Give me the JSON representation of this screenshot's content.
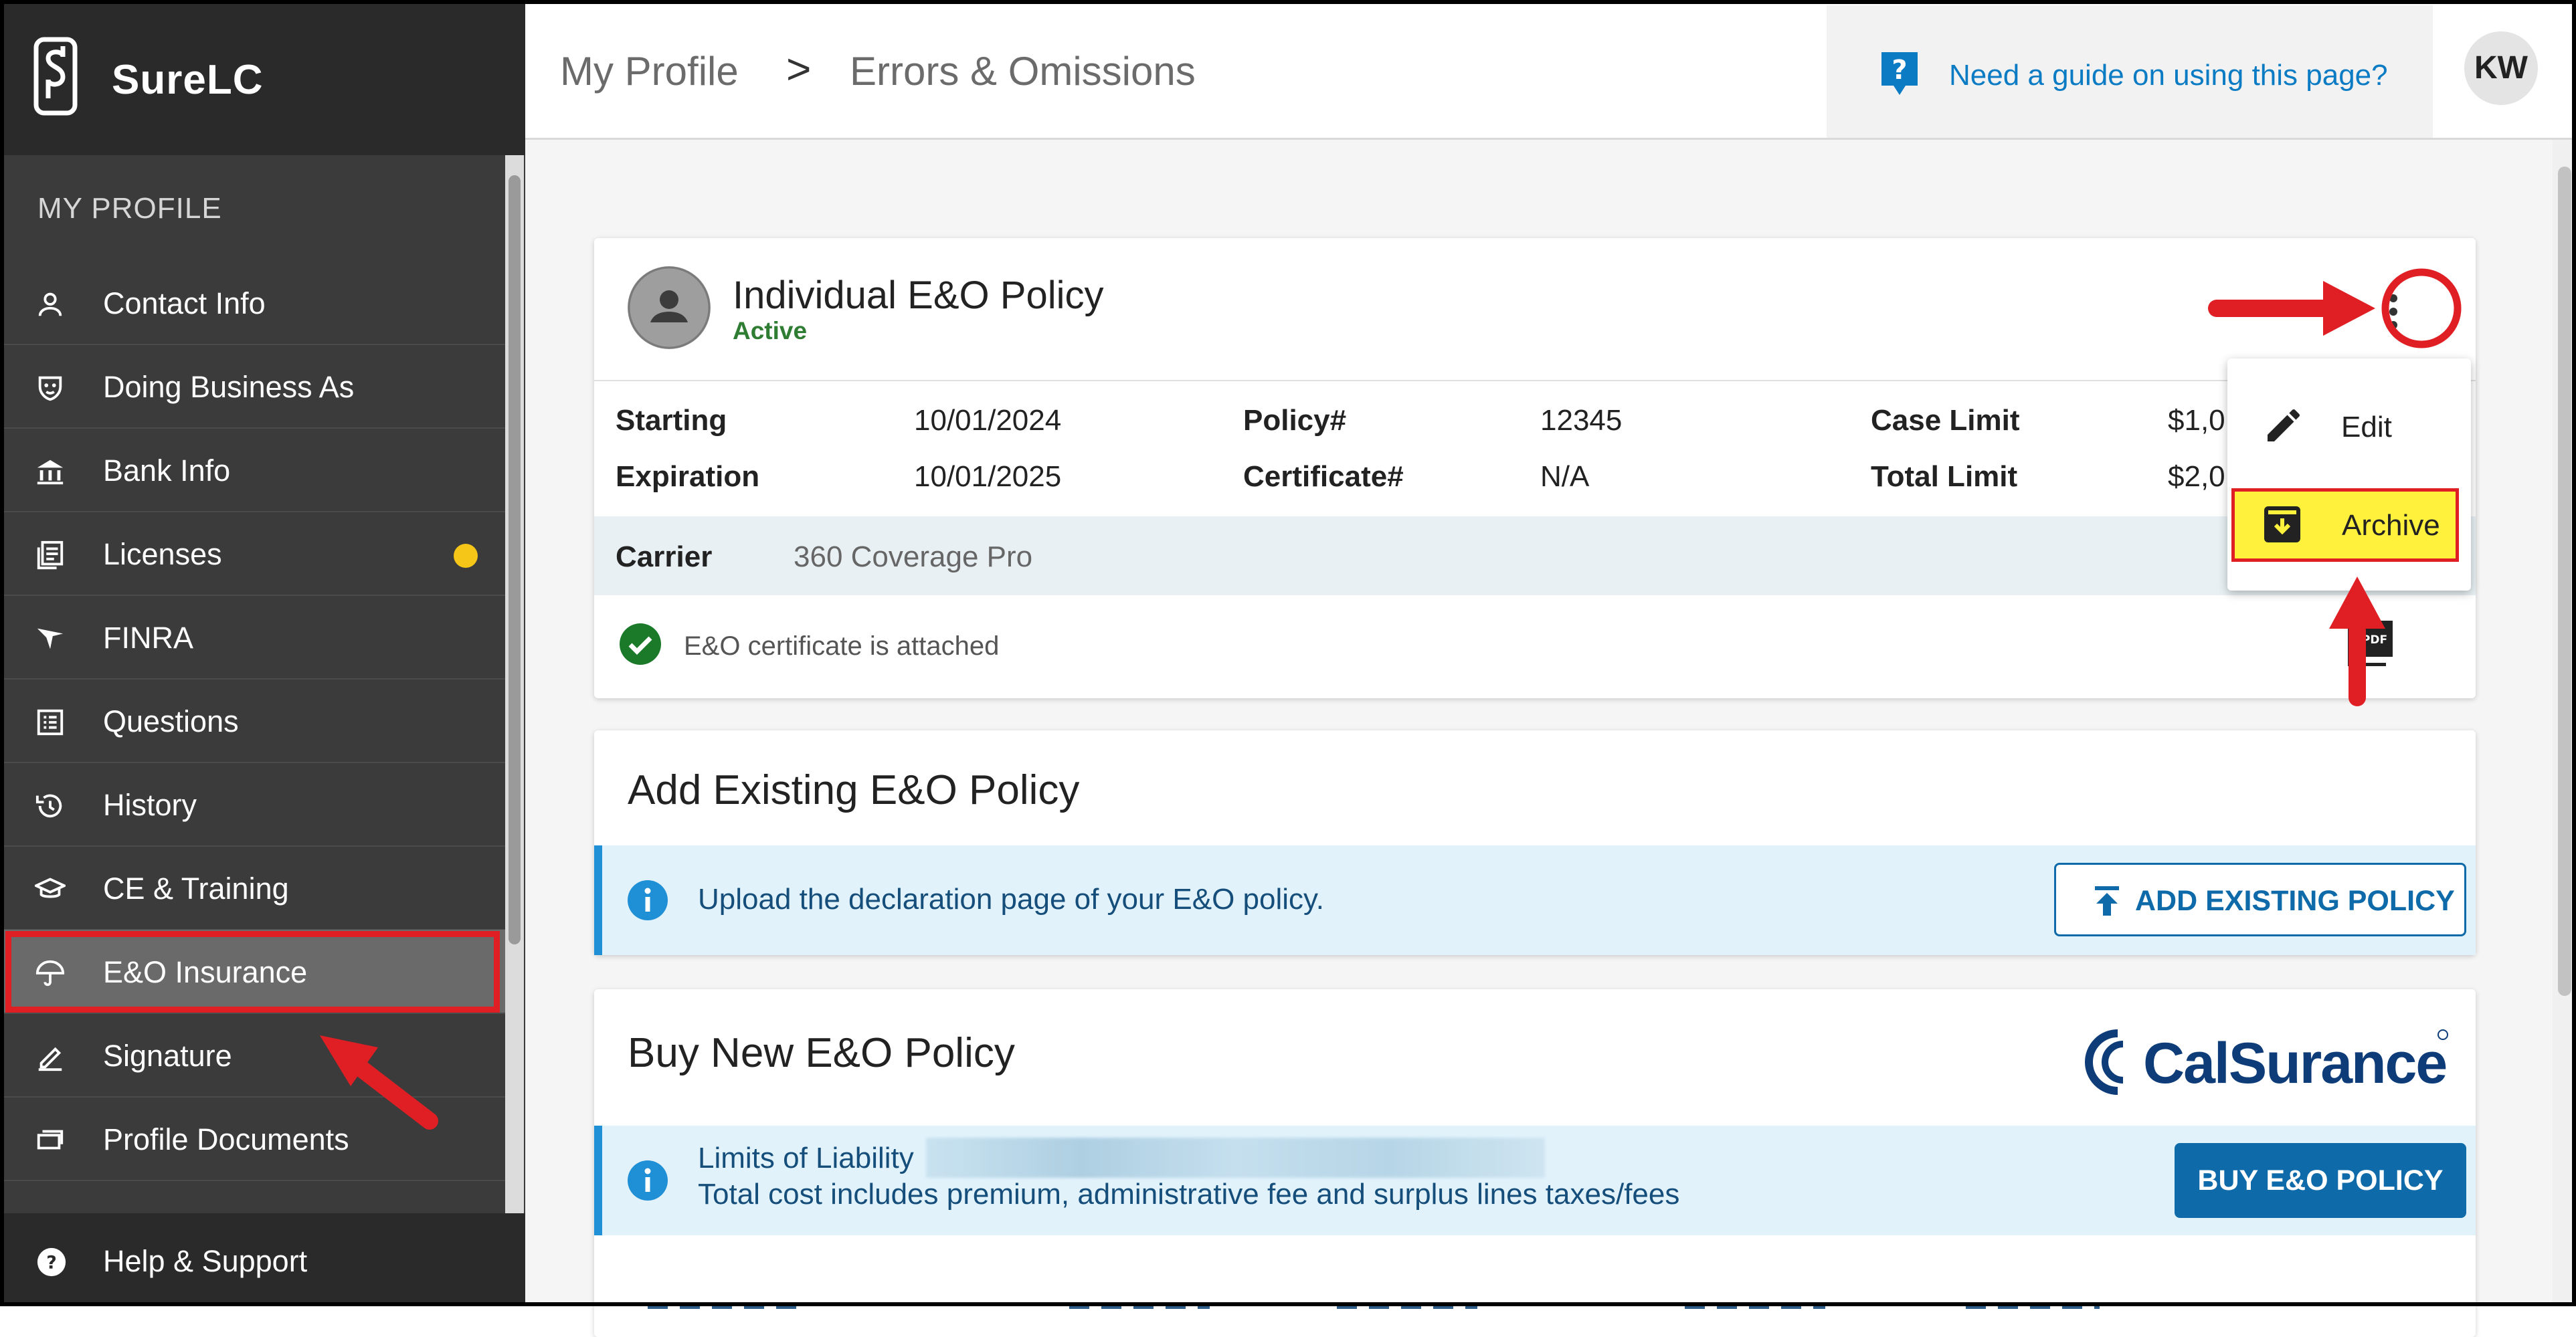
{
  "brand": {
    "name": "SureLC"
  },
  "sidebar": {
    "section_title": "MY PROFILE",
    "items": [
      {
        "label": "Contact Info",
        "icon": "person-icon"
      },
      {
        "label": "Doing Business As",
        "icon": "mask-icon"
      },
      {
        "label": "Bank Info",
        "icon": "bank-icon"
      },
      {
        "label": "Licenses",
        "icon": "license-icon",
        "badge_color": "#f5c518"
      },
      {
        "label": "FINRA",
        "icon": "finra-icon"
      },
      {
        "label": "Questions",
        "icon": "list-icon"
      },
      {
        "label": "History",
        "icon": "history-icon"
      },
      {
        "label": "CE & Training",
        "icon": "graduation-cap-icon"
      },
      {
        "label": "E&O Insurance",
        "icon": "umbrella-icon",
        "active": true
      },
      {
        "label": "Signature",
        "icon": "pen-icon"
      },
      {
        "label": "Profile Documents",
        "icon": "documents-icon"
      }
    ],
    "footer": {
      "label": "Help & Support",
      "icon": "help-icon"
    }
  },
  "header": {
    "breadcrumb": [
      "My Profile",
      "Errors & Omissions"
    ],
    "separator": ">",
    "guide_link": "Need a guide on using this page?",
    "avatar_initials": "KW"
  },
  "policy_card": {
    "title": "Individual E&O Policy",
    "status": "Active",
    "fields": {
      "starting_label": "Starting",
      "starting_value": "10/01/2024",
      "expiration_label": "Expiration",
      "expiration_value": "10/01/2025",
      "policy_label": "Policy#",
      "policy_value": "12345",
      "certificate_label": "Certificate#",
      "certificate_value": "N/A",
      "case_limit_label": "Case Limit",
      "case_limit_value": "$1,0",
      "total_limit_label": "Total Limit",
      "total_limit_value": "$2,0"
    },
    "carrier_label": "Carrier",
    "carrier_value": "360 Coverage Pro",
    "certificate_status": "E&O certificate is attached"
  },
  "menu": {
    "items": [
      "Edit",
      "Archive"
    ]
  },
  "add_existing": {
    "title": "Add Existing E&O Policy",
    "info": "Upload the declaration page of your E&O policy.",
    "button": "ADD EXISTING POLICY"
  },
  "buy_new": {
    "title": "Buy New E&O Policy",
    "logo_text": "CalSurance",
    "limits_label": "Limits of Liability",
    "cost_text": "Total cost includes premium, administrative fee and surplus lines taxes/fees",
    "button": "BUY E&O POLICY"
  },
  "colors": {
    "sidebar_bg": "#3b3b3b",
    "accent_blue": "#0e6aa8",
    "active_green": "#2e7d32",
    "annotation_red": "#e01f25",
    "highlight_yellow": "#fff13c"
  }
}
